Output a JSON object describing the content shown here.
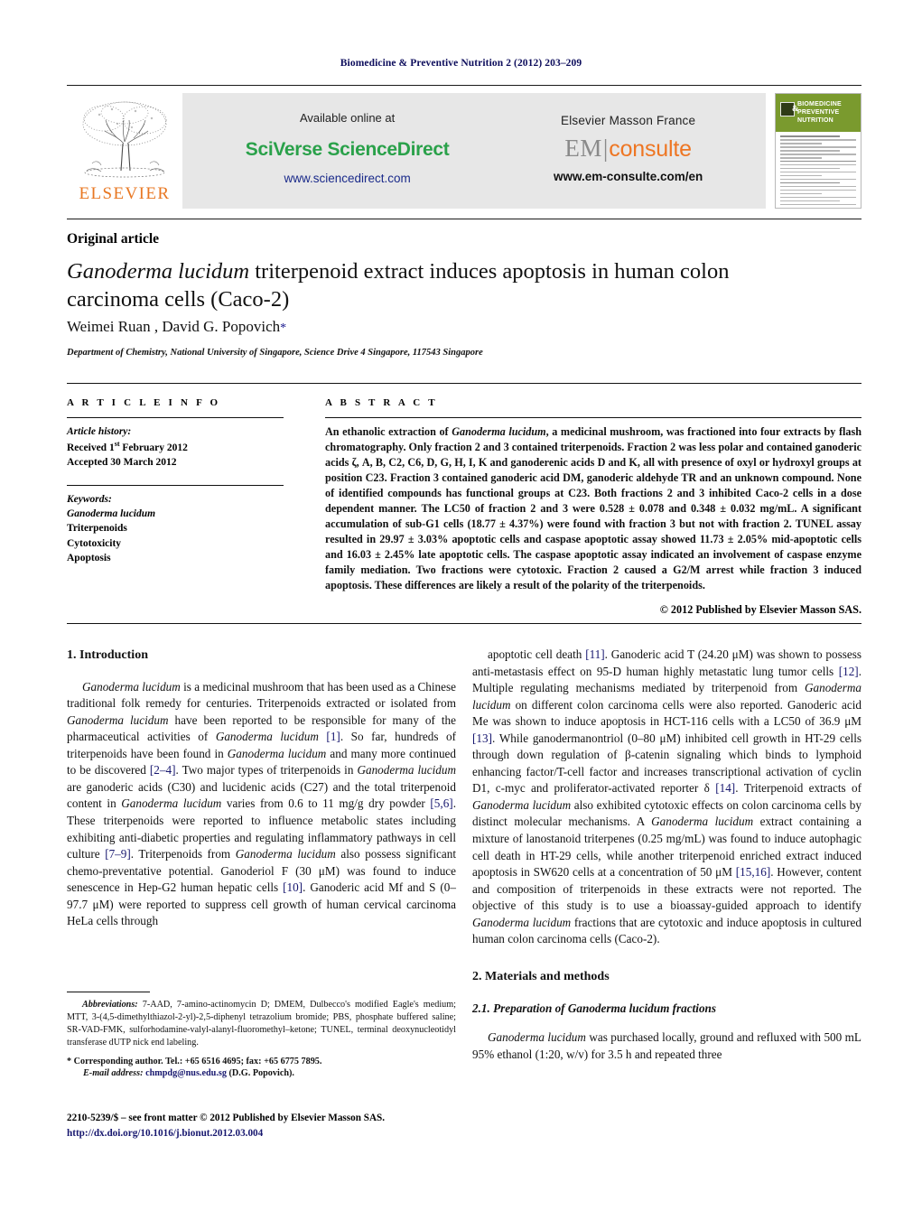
{
  "running_head": "Biomedicine & Preventive Nutrition 2 (2012) 203–209",
  "masthead": {
    "publisher_logo_word": "ELSEVIER",
    "available_online": "Available online at",
    "platform_name": "SciVerse ScienceDirect",
    "platform_url": "www.sciencedirect.com",
    "imprint": "Elsevier Masson France",
    "em_mark_left": "EM",
    "em_mark_right": "consulte",
    "em_url": "www.em-consulte.com/en",
    "cover_title_line1": "BIOMEDICINE",
    "cover_title_line2": "PREVENTIVE NUTRITION",
    "cover_amp": "&",
    "colors": {
      "sciencedirect_green": "#2aa14a",
      "link_blue": "#1a2a8a",
      "elsevier_orange": "#e87722",
      "consulte_orange": "#ee7623",
      "cover_green": "#7a9a2e",
      "band_grey": "#e7e7e7"
    }
  },
  "article": {
    "type_label": "Original article",
    "title_italic": "Ganoderma lucidum",
    "title_rest": " triterpenoid extract induces apoptosis in human colon carcinoma cells (Caco-2)",
    "authors": "Weimei Ruan , David G. Popovich",
    "corresponding_marker": "*",
    "affiliation": "Department of Chemistry, National University of Singapore, Science Drive 4 Singapore, 117543 Singapore"
  },
  "article_info": {
    "heading": "A R T I C L E   I N F O",
    "history_label": "Article history:",
    "received": "Received 1",
    "received_sup": "st",
    "received_tail": " February 2012",
    "accepted": "Accepted 30 March 2012",
    "keywords_label": "Keywords:",
    "keywords": [
      "Ganoderma lucidum",
      "Triterpenoids",
      "Cytotoxicity",
      "Apoptosis"
    ]
  },
  "abstract": {
    "heading": "A B S T R A C T",
    "p1_a": "An ethanolic extraction of ",
    "p1_it1": "Ganoderma lucidum",
    "p1_b": ", a medicinal mushroom, was fractioned into four extracts by flash chromatography. Only fraction 2 and 3 contained triterpenoids. Fraction 2 was less polar and contained ganoderic acids ζ, A, B, C2, C6, D, G, H, I, K and ganoderenic acids D and K, all with presence of oxyl or hydroxyl groups at position C23. Fraction 3 contained ganoderic acid DM, ganoderic aldehyde TR and an unknown compound. None of identified compounds has functional groups at C23. Both fractions 2 and 3 inhibited Caco-2 cells in a dose dependent manner. The LC50 of fraction 2 and 3 were 0.528 ± 0.078 and 0.348 ± 0.032 mg/mL. A significant accumulation of sub-G1 cells (18.77 ± 4.37%) were found with fraction 3 but not with fraction 2. TUNEL assay resulted in 29.97 ± 3.03% apoptotic cells and caspase apoptotic assay showed 11.73 ± 2.05% mid-apoptotic cells and 16.03 ± 2.45% late apoptotic cells. The caspase apoptotic assay indicated an involvement of caspase enzyme family mediation. Two fractions were cytotoxic. Fraction 2 caused a G2/M arrest while fraction 3 induced apoptosis. These differences are likely a result of the polarity of the triterpenoids.",
    "copyright": "© 2012 Published by Elsevier Masson SAS."
  },
  "body": {
    "intro_heading": "1. Introduction",
    "intro_p1_parts": [
      {
        "t": "Ganoderma lucidum",
        "i": true
      },
      {
        "t": " is a medicinal mushroom that has been used as a Chinese traditional folk remedy for centuries. Triterpenoids extracted or isolated from "
      },
      {
        "t": "Ganoderma lucidum",
        "i": true
      },
      {
        "t": " have been reported to be responsible for many of the pharmaceutical activities of "
      },
      {
        "t": "Ganoderma lucidum",
        "i": true
      },
      {
        "t": " "
      },
      {
        "t": "[1]",
        "r": true
      },
      {
        "t": ". So far, hundreds of triterpenoids have been found in "
      },
      {
        "t": "Ganoderma lucidum",
        "i": true
      },
      {
        "t": " and many more continued to be discovered "
      },
      {
        "t": "[2–4]",
        "r": true
      },
      {
        "t": ". Two major types of triterpenoids in "
      },
      {
        "t": "Ganoderma lucidum",
        "i": true
      },
      {
        "t": " are ganoderic acids (C30) and lucidenic acids (C27) and the total triterpenoid content in "
      },
      {
        "t": "Ganoderma lucidum",
        "i": true
      },
      {
        "t": " varies from 0.6 to 11 mg/g dry powder "
      },
      {
        "t": "[5,6]",
        "r": true
      },
      {
        "t": ". These triterpenoids were reported to influence metabolic states including exhibiting anti-diabetic properties and regulating inflammatory pathways in cell culture "
      },
      {
        "t": "[7–9]",
        "r": true
      },
      {
        "t": ". Triterpenoids from "
      },
      {
        "t": "Ganoderma lucidum",
        "i": true
      },
      {
        "t": " also possess significant chemo-preventative potential. Ganoderiol F (30 μM) was found to induce senescence in Hep-G2 human hepatic cells "
      },
      {
        "t": "[10]",
        "r": true
      },
      {
        "t": ". Ganoderic acid Mf and S (0–97.7 μM) were reported to suppress cell growth of human cervical carcinoma HeLa cells through "
      }
    ],
    "right_p1_parts": [
      {
        "t": "apoptotic cell death "
      },
      {
        "t": "[11]",
        "r": true
      },
      {
        "t": ". Ganoderic acid T (24.20 μM) was shown to possess anti-metastasis effect on 95-D human highly metastatic lung tumor cells "
      },
      {
        "t": "[12]",
        "r": true
      },
      {
        "t": ". Multiple regulating mechanisms mediated by triterpenoid from "
      },
      {
        "t": "Ganoderma lucidum",
        "i": true
      },
      {
        "t": " on different colon carcinoma cells were also reported. Ganoderic acid Me was shown to induce apoptosis in HCT-116 cells with a LC50 of 36.9 μM "
      },
      {
        "t": "[13]",
        "r": true
      },
      {
        "t": ". While ganodermanontriol (0–80 μM) inhibited cell growth in HT-29 cells through down regulation of β-catenin signaling which binds to lymphoid enhancing factor/T-cell factor and increases transcriptional activation of cyclin D1, c-myc and proliferator-activated reporter δ "
      },
      {
        "t": "[14]",
        "r": true
      },
      {
        "t": ". Triterpenoid extracts of "
      },
      {
        "t": "Ganoderma lucidum",
        "i": true
      },
      {
        "t": " also exhibited cytotoxic effects on colon carcinoma cells by distinct molecular mechanisms. A "
      },
      {
        "t": "Ganoderma lucidum",
        "i": true
      },
      {
        "t": " extract containing a mixture of lanostanoid triterpenes (0.25 mg/mL) was found to induce autophagic cell death in HT-29 cells, while another triterpenoid enriched extract induced apoptosis in SW620 cells at a concentration of 50 μM "
      },
      {
        "t": "[15,16]",
        "r": true
      },
      {
        "t": ". However, content and composition of triterpenoids in these extracts were not reported. The objective of this study is to use a bioassay-guided approach to identify "
      },
      {
        "t": "Ganoderma lucidum",
        "i": true
      },
      {
        "t": " fractions that are cytotoxic and induce apoptosis in cultured human colon carcinoma cells (Caco-2)."
      }
    ],
    "methods_heading": "2. Materials and methods",
    "methods_sub_heading_a": "2.1. Preparation of ",
    "methods_sub_heading_it": "Ganoderma lucidum",
    "methods_sub_heading_b": " fractions",
    "methods_p1_parts": [
      {
        "t": "Ganoderma lucidum",
        "i": true
      },
      {
        "t": " was purchased locally, ground and refluxed with 500 mL 95% ethanol (1:20, w/v) for 3.5 h and repeated three"
      }
    ]
  },
  "footnotes": {
    "abbrev_label": "Abbreviations:",
    "abbrev_text": " 7-AAD, 7-amino-actinomycin D; DMEM, Dulbecco's modified Eagle's medium; MTT, 3-(4,5-dimethylthiazol-2-yl)-2,5-diphenyl tetrazolium bromide; PBS, phosphate buffered saline; SR-VAD-FMK, sulforhodamine-valyl-alanyl-fluoromethyl–ketone; TUNEL, terminal deoxynucleotidyl transferase dUTP nick end labeling.",
    "corresponding_star": "*",
    "corresponding_text": "Corresponding author. Tel.: +65 6516 4695; fax: +65 6775 7895.",
    "email_label": "E-mail address:",
    "email": "chmpdg@nus.edu.sg",
    "email_owner": "(D.G. Popovich)."
  },
  "footer": {
    "issn_line": "2210-5239/$ – see front matter © 2012 Published by Elsevier Masson SAS.",
    "doi": "http://dx.doi.org/10.1016/j.bionut.2012.03.004"
  }
}
